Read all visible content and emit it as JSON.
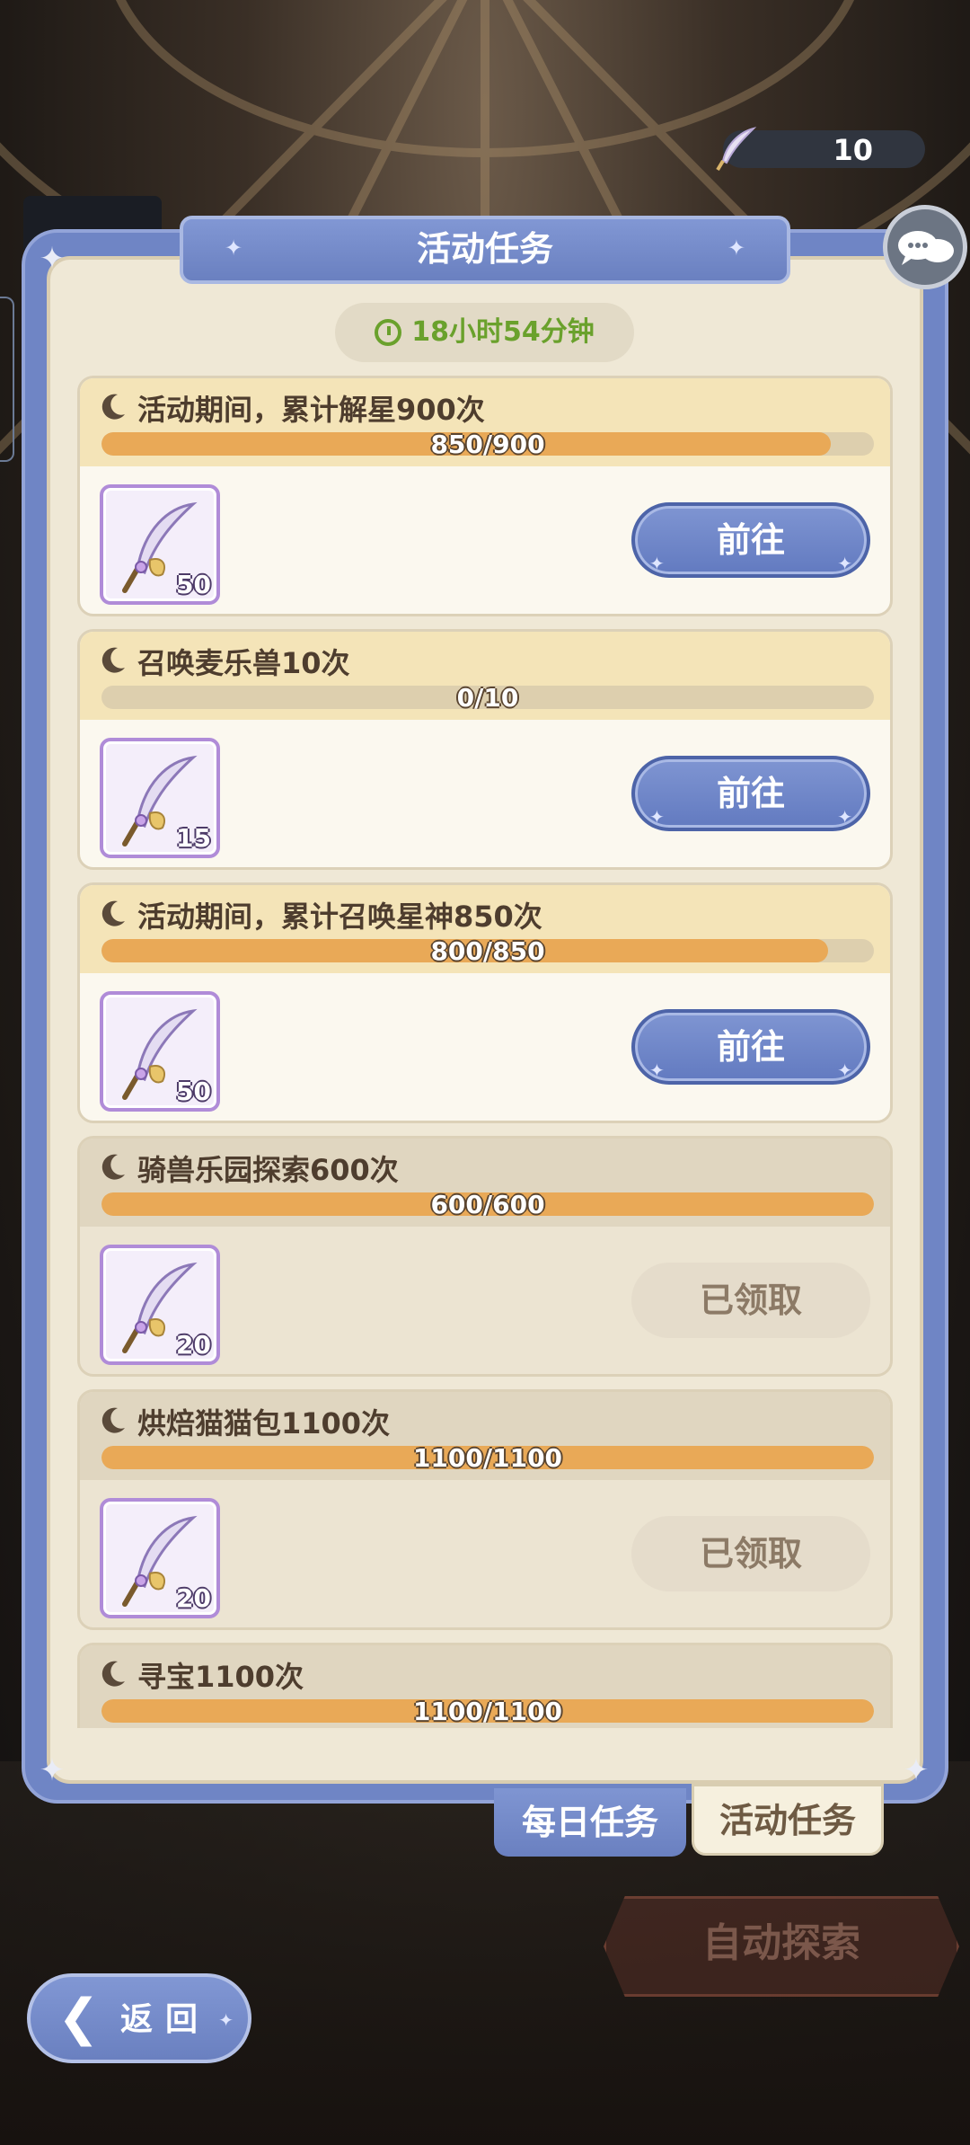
{
  "currency": {
    "value": "10"
  },
  "panel": {
    "title": "活动任务",
    "timer": "18小时54分钟"
  },
  "tasks": [
    {
      "desc": "活动期间，累计解星900次",
      "current": 850,
      "total": 900,
      "progress_text": "850/900",
      "reward_qty": "50",
      "action": "前往",
      "done": false
    },
    {
      "desc": "召唤麦乐兽10次",
      "current": 0,
      "total": 10,
      "progress_text": "0/10",
      "reward_qty": "15",
      "action": "前往",
      "done": false
    },
    {
      "desc": "活动期间，累计召唤星神850次",
      "current": 800,
      "total": 850,
      "progress_text": "800/850",
      "reward_qty": "50",
      "action": "前往",
      "done": false
    },
    {
      "desc": "骑兽乐园探索600次",
      "current": 600,
      "total": 600,
      "progress_text": "600/600",
      "reward_qty": "20",
      "action": "已领取",
      "done": true
    },
    {
      "desc": "烘焙猫猫包1100次",
      "current": 1100,
      "total": 1100,
      "progress_text": "1100/1100",
      "reward_qty": "20",
      "action": "已领取",
      "done": true
    },
    {
      "desc": "寻宝1100次",
      "current": 1100,
      "total": 1100,
      "progress_text": "1100/1100",
      "reward_qty": "",
      "action": "",
      "done": true
    }
  ],
  "tabs": {
    "daily": "每日任务",
    "event": "活动任务"
  },
  "auto_explore": "自动探索",
  "back": "返回",
  "colors": {
    "accent_blue": "#6f85c5",
    "progress": "#e9a957",
    "timer_green": "#6aa12c"
  }
}
